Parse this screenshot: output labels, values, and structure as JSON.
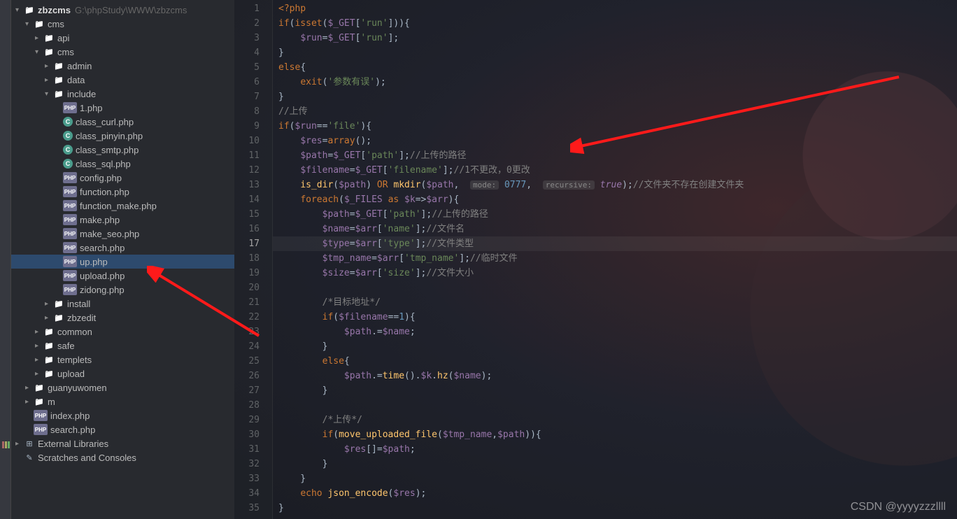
{
  "project": {
    "root": "zbzcms",
    "rootPath": "G:\\phpStudy\\WWW\\zbzcms"
  },
  "tree": [
    {
      "depth": 0,
      "chev": "down",
      "icon": "mod",
      "label": "zbzcms",
      "path": "G:\\phpStudy\\WWW\\zbzcms",
      "root": true
    },
    {
      "depth": 1,
      "chev": "down",
      "icon": "folder",
      "label": "cms"
    },
    {
      "depth": 2,
      "chev": "right",
      "icon": "folder",
      "label": "api"
    },
    {
      "depth": 2,
      "chev": "down",
      "icon": "folder",
      "label": "cms"
    },
    {
      "depth": 3,
      "chev": "right",
      "icon": "folder",
      "label": "admin"
    },
    {
      "depth": 3,
      "chev": "right",
      "icon": "folder",
      "label": "data"
    },
    {
      "depth": 3,
      "chev": "down",
      "icon": "folder",
      "label": "include"
    },
    {
      "depth": 4,
      "chev": "",
      "icon": "php",
      "label": "1.php"
    },
    {
      "depth": 4,
      "chev": "",
      "icon": "class",
      "label": "class_curl.php"
    },
    {
      "depth": 4,
      "chev": "",
      "icon": "class",
      "label": "class_pinyin.php"
    },
    {
      "depth": 4,
      "chev": "",
      "icon": "class",
      "label": "class_smtp.php"
    },
    {
      "depth": 4,
      "chev": "",
      "icon": "class",
      "label": "class_sql.php"
    },
    {
      "depth": 4,
      "chev": "",
      "icon": "php",
      "label": "config.php"
    },
    {
      "depth": 4,
      "chev": "",
      "icon": "php",
      "label": "function.php"
    },
    {
      "depth": 4,
      "chev": "",
      "icon": "php",
      "label": "function_make.php"
    },
    {
      "depth": 4,
      "chev": "",
      "icon": "php",
      "label": "make.php"
    },
    {
      "depth": 4,
      "chev": "",
      "icon": "php",
      "label": "make_seo.php"
    },
    {
      "depth": 4,
      "chev": "",
      "icon": "php",
      "label": "search.php"
    },
    {
      "depth": 4,
      "chev": "",
      "icon": "php",
      "label": "up.php",
      "selected": true
    },
    {
      "depth": 4,
      "chev": "",
      "icon": "php",
      "label": "upload.php"
    },
    {
      "depth": 4,
      "chev": "",
      "icon": "php",
      "label": "zidong.php"
    },
    {
      "depth": 3,
      "chev": "right",
      "icon": "folder",
      "label": "install"
    },
    {
      "depth": 3,
      "chev": "right",
      "icon": "folder",
      "label": "zbzedit"
    },
    {
      "depth": 2,
      "chev": "right",
      "icon": "folder",
      "label": "common"
    },
    {
      "depth": 2,
      "chev": "right",
      "icon": "folder",
      "label": "safe"
    },
    {
      "depth": 2,
      "chev": "right",
      "icon": "folder",
      "label": "templets"
    },
    {
      "depth": 2,
      "chev": "right",
      "icon": "folder",
      "label": "upload"
    },
    {
      "depth": 1,
      "chev": "right",
      "icon": "folder",
      "label": "guanyuwomen"
    },
    {
      "depth": 1,
      "chev": "right",
      "icon": "folder",
      "label": "m"
    },
    {
      "depth": 1,
      "chev": "",
      "icon": "php",
      "label": "index.php"
    },
    {
      "depth": 1,
      "chev": "",
      "icon": "php",
      "label": "search.php"
    }
  ],
  "bottomTree": [
    {
      "depth": 0,
      "chev": "right",
      "icon": "lib",
      "label": "External Libraries"
    },
    {
      "depth": 0,
      "chev": "",
      "icon": "scratch",
      "label": "Scratches and Consoles"
    }
  ],
  "gutter": {
    "lines": [
      1,
      2,
      3,
      4,
      5,
      6,
      7,
      8,
      9,
      10,
      11,
      12,
      13,
      14,
      15,
      16,
      17,
      18,
      19,
      20,
      21,
      22,
      23,
      24,
      25,
      26,
      27,
      28,
      29,
      30,
      31,
      32,
      33,
      34,
      35
    ],
    "current": 17
  },
  "code": [
    {
      "html": "<span class='tag'>&lt;?php</span>"
    },
    {
      "html": "<span class='k'>if</span>(<span class='k'>isset</span>(<span class='v'>$_GET</span>[<span class='s'>'run'</span>])){"
    },
    {
      "html": "    <span class='v'>$run</span>=<span class='v'>$_GET</span>[<span class='s'>'run'</span>];"
    },
    {
      "html": "}"
    },
    {
      "html": "<span class='k'>else</span>{"
    },
    {
      "html": "    <span class='k'>exit</span>(<span class='s'>'参数有误'</span>);"
    },
    {
      "html": "}"
    },
    {
      "html": "<span class='c'>//上传</span>"
    },
    {
      "html": "<span class='k'>if</span>(<span class='v'>$run</span>==<span class='s'>'file'</span>){"
    },
    {
      "html": "    <span class='v'>$res</span>=<span class='k'>array</span>();"
    },
    {
      "html": "    <span class='v'>$path</span>=<span class='v'>$_GET</span>[<span class='s'>'path'</span>];<span class='c'>//上传的路径</span>"
    },
    {
      "html": "    <span class='v'>$filename</span>=<span class='v'>$_GET</span>[<span class='s'>'filename'</span>];<span class='c'>//1不更改，0更改</span>"
    },
    {
      "html": "    <span class='f'>is_dir</span>(<span class='v'>$path</span>) <span class='k'>OR</span> <span class='f'>mkdir</span>(<span class='v'>$path</span>,  <span class='hint'>mode:</span> <span class='n'>0777</span>,  <span class='hint'>recursive:</span> <span class='const'>true</span>);<span class='c'>//文件夹不存在创建文件夹</span>"
    },
    {
      "html": "    <span class='k'>foreach</span>(<span class='v'>$_FILES</span> <span class='k'>as</span> <span class='v'>$k</span>=&gt;<span class='v'>$arr</span>){"
    },
    {
      "html": "        <span class='v'>$path</span>=<span class='v'>$_GET</span>[<span class='s'>'path'</span>];<span class='c'>//上传的路径</span>"
    },
    {
      "html": "        <span class='v'>$name</span>=<span class='v'>$arr</span>[<span class='s'>'name'</span>];<span class='c'>//文件名</span>"
    },
    {
      "html": "        <span class='v'>$type</span>=<span class='v'>$arr</span>[<span class='s'>'type'</span>];<span class='c'>//文件类型</span>",
      "hl": true
    },
    {
      "html": "        <span class='v'>$tmp_name</span>=<span class='v'>$arr</span>[<span class='s'>'tmp_name'</span>];<span class='c'>//临时文件</span>"
    },
    {
      "html": "        <span class='v'>$size</span>=<span class='v'>$arr</span>[<span class='s'>'size'</span>];<span class='c'>//文件大小</span>"
    },
    {
      "html": ""
    },
    {
      "html": "        <span class='c'>/*目标地址*/</span>"
    },
    {
      "html": "        <span class='k'>if</span>(<span class='v'>$filename</span>==<span class='n'>1</span>){"
    },
    {
      "html": "            <span class='v'>$path</span>.=<span class='v'>$name</span>;"
    },
    {
      "html": "        }"
    },
    {
      "html": "        <span class='k'>else</span>{"
    },
    {
      "html": "            <span class='v'>$path</span>.=<span class='f'>time</span>().<span class='v'>$k</span>.<span class='f'>hz</span>(<span class='v'>$name</span>);"
    },
    {
      "html": "        }"
    },
    {
      "html": ""
    },
    {
      "html": "        <span class='c'>/*上传*/</span>"
    },
    {
      "html": "        <span class='k'>if</span>(<span class='f'>move_uploaded_file</span>(<span class='v'>$tmp_name</span>,<span class='v'>$path</span>)){"
    },
    {
      "html": "            <span class='v'>$res</span>[]=<span class='v'>$path</span>;"
    },
    {
      "html": "        }"
    },
    {
      "html": "    }"
    },
    {
      "html": "    <span class='k'>echo</span> <span class='f'>json_encode</span>(<span class='v'>$res</span>);"
    },
    {
      "html": "}"
    }
  ],
  "watermark": "CSDN @yyyyzzzllll"
}
